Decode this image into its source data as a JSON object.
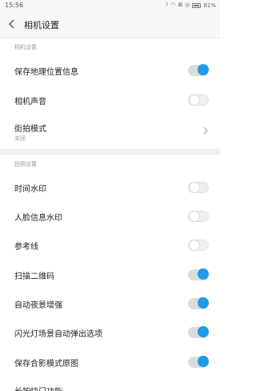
{
  "status": {
    "time": "15:56",
    "battery_text": "81%"
  },
  "header": {
    "title": "相机设置"
  },
  "sections": {
    "camera_settings": "相机设置",
    "shooting_settings": "拍照设置"
  },
  "rows": {
    "save_location": {
      "label": "保存地理位置信息",
      "state": "on"
    },
    "camera_sound": {
      "label": "相机声音",
      "state": "off"
    },
    "street_mode": {
      "label": "街拍模式",
      "sub": "关闭"
    },
    "time_watermark": {
      "label": "时间水印",
      "state": "off"
    },
    "face_watermark": {
      "label": "人脸信息水印",
      "state": "off"
    },
    "reference_lines": {
      "label": "参考线",
      "state": "off"
    },
    "scan_qr": {
      "label": "扫描二维码",
      "state": "on"
    },
    "auto_night": {
      "label": "自动夜景增强",
      "state": "on"
    },
    "flash_popup": {
      "label": "闪光灯场景自动弹出选项",
      "state": "on"
    },
    "save_group_original": {
      "label": "保存合影模式原图",
      "state": "on"
    },
    "long_press_shutter": {
      "label": "长按快门功能"
    }
  },
  "colors": {
    "accent": "#1e9be9"
  },
  "icons": {
    "back": "chevron-left-icon",
    "more": "chevron-right-icon"
  }
}
